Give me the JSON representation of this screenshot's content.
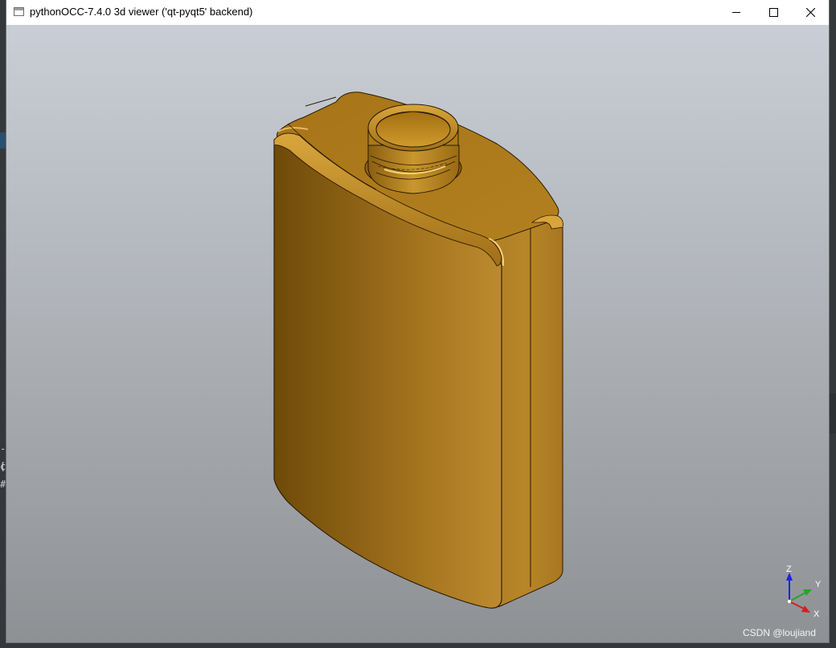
{
  "window": {
    "title": "pythonOCC-7.4.0 3d viewer ('qt-pyqt5' backend)",
    "controls": {
      "minimize": "minimize-icon",
      "maximize": "maximize-icon",
      "close": "close-icon"
    }
  },
  "background_terminal": {
    "lines": [
      "-[",
      "c(",
      "#"
    ]
  },
  "viewport": {
    "model": "3D bottle model",
    "model_color": "#b8862b",
    "background_top": "#c9ced6",
    "background_bottom": "#8e9194"
  },
  "trihedron": {
    "z_label": "Z",
    "y_label": "Y",
    "x_label": "X",
    "z_color": "#1d22e0",
    "y_color": "#22a822",
    "x_color": "#d22020"
  },
  "watermark": "CSDN @loujiand"
}
